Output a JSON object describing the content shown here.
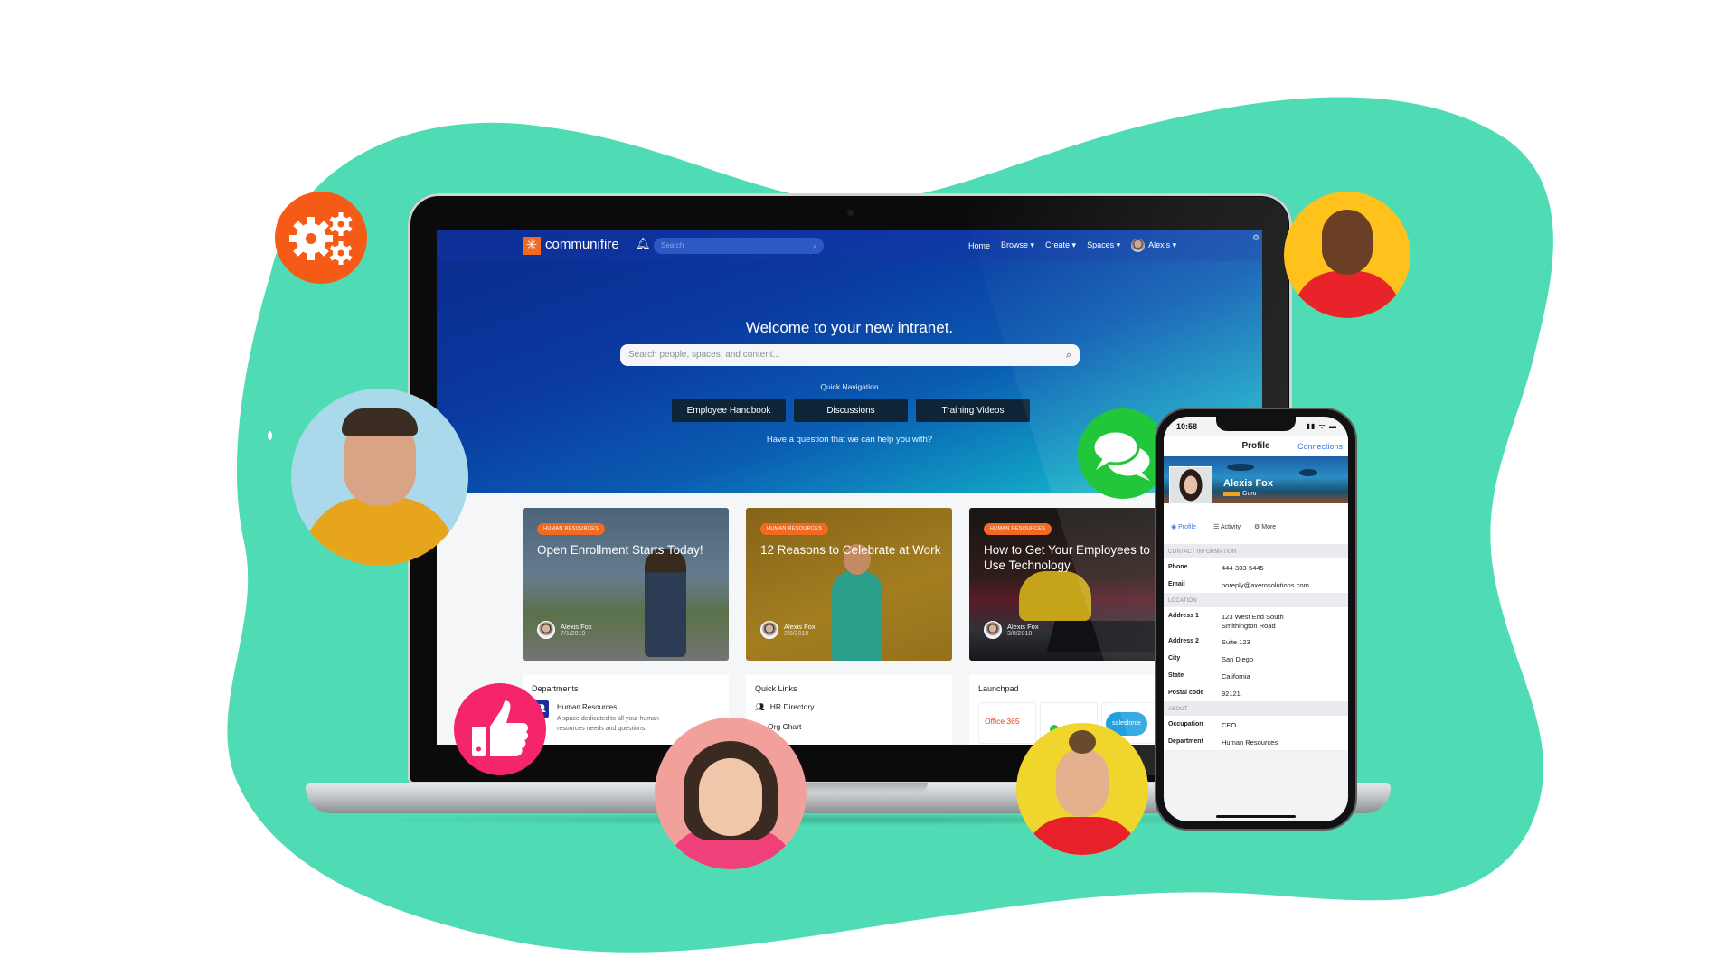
{
  "colors": {
    "blob": "#4fdcb4",
    "brand_orange": "#f26a21",
    "gear_badge": "#f65a17",
    "chat_badge": "#22c63a",
    "like_badge": "#f5256d",
    "link_blue": "#3d7be0"
  },
  "app": {
    "logo_icon": "sunburst-icon",
    "logo_glyph": "✳",
    "brand_name": "communifire",
    "bell_glyph": "🔔",
    "nav_search_placeholder": "Search",
    "search_glyph": "⌕",
    "nav_links": [
      "Home",
      "Browse ▾",
      "Create ▾",
      "Spaces ▾"
    ],
    "user_name": "Alexis ▾",
    "settings_glyph": "⚙"
  },
  "hero": {
    "title": "Welcome to your new intranet.",
    "search_placeholder": "Search people, spaces, and content...",
    "quick_nav_label": "Quick Navigation",
    "quick_nav_buttons": [
      "Employee Handbook",
      "Discussions",
      "Training Videos"
    ],
    "help_text": "Have a question that we can help you with?"
  },
  "cards": [
    {
      "badge": "HUMAN RESOURCES",
      "title": "Open Enrollment Starts Today!",
      "author": "Alexis Fox",
      "date": "7/1/2019"
    },
    {
      "badge": "HUMAN RESOURCES",
      "title": "12 Reasons to Celebrate at Work",
      "author": "Alexis Fox",
      "date": "3/8/2018"
    },
    {
      "badge": "HUMAN RESOURCES",
      "title": "How to Get Your Employees to Use Technology",
      "author": "Alexis Fox",
      "date": "3/8/2018"
    }
  ],
  "departments": {
    "title": "Departments",
    "items": [
      {
        "name": "Human Resources",
        "description": "A space dedicated to all your human resources needs and questions."
      }
    ]
  },
  "quick_links": {
    "title": "Quick Links",
    "items": [
      {
        "icon": "users-icon",
        "glyph": "👥",
        "label": "HR Directory"
      },
      {
        "icon": "org-chart-icon",
        "glyph": "",
        "label": "Org Chart"
      }
    ]
  },
  "launchpad": {
    "title": "Launchpad",
    "tiles": [
      "Office 365",
      "",
      "salesforce"
    ]
  },
  "phone": {
    "time": "10:58",
    "status_icons": "▮▮ ᯤ ▬",
    "header_title": "Profile",
    "header_link": "Connections",
    "name": "Alexis Fox",
    "rank": "Guru",
    "tabs": [
      "Profile",
      "Activity",
      "More"
    ],
    "tab_glyphs": [
      "◉",
      "☰",
      "⚙"
    ],
    "sections": [
      {
        "title": "CONTACT INFORMATION",
        "rows": [
          [
            "Phone",
            "444-333-5445"
          ],
          [
            "Email",
            "noreply@axerosolutions.com"
          ]
        ]
      },
      {
        "title": "LOCATION",
        "rows": [
          [
            "Address 1",
            "123 West End South Smithington Road"
          ],
          [
            "Address 2",
            "Suite 123"
          ],
          [
            "City",
            "San Diego"
          ],
          [
            "State",
            "California"
          ],
          [
            "Postal code",
            "92121"
          ]
        ]
      },
      {
        "title": "ABOUT",
        "rows": [
          [
            "Occupation",
            "CEO"
          ],
          [
            "Department",
            "Human Resources"
          ]
        ]
      }
    ]
  },
  "badges": {
    "gear": "gears-icon",
    "chat": "chat-bubbles-icon",
    "like": "thumbs-up-icon"
  }
}
